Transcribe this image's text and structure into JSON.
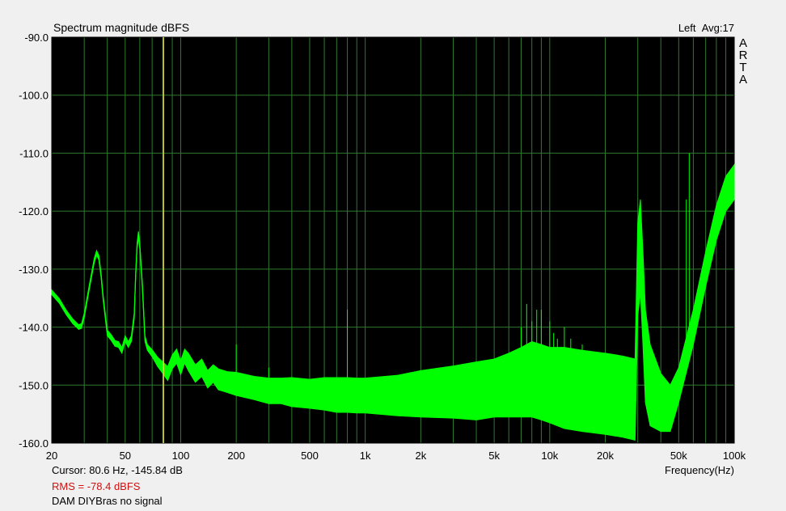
{
  "chart_data": {
    "type": "line",
    "title": "Spectrum magnitude dBFS",
    "channel_label": "Left",
    "avg_label": "Avg:17",
    "xlabel": "Frequency(Hz)",
    "ylabel": "",
    "x_scale": "log",
    "xlim": [
      20,
      100000
    ],
    "ylim": [
      -160,
      -90
    ],
    "grid": true,
    "legend": "none",
    "x_tick_labels": [
      {
        "value": 20,
        "label": "20"
      },
      {
        "value": 50,
        "label": "50"
      },
      {
        "value": 100,
        "label": "100"
      },
      {
        "value": 200,
        "label": "200"
      },
      {
        "value": 500,
        "label": "500"
      },
      {
        "value": 1000,
        "label": "1k"
      },
      {
        "value": 2000,
        "label": "2k"
      },
      {
        "value": 5000,
        "label": "5k"
      },
      {
        "value": 10000,
        "label": "10k"
      },
      {
        "value": 20000,
        "label": "20k"
      },
      {
        "value": 50000,
        "label": "50k"
      },
      {
        "value": 100000,
        "label": "100k"
      }
    ],
    "y_tick_labels": [
      {
        "value": -90,
        "label": "-90.0"
      },
      {
        "value": -100,
        "label": "-100.0"
      },
      {
        "value": -110,
        "label": "-110.0"
      },
      {
        "value": -120,
        "label": "-120.0"
      },
      {
        "value": -130,
        "label": "-130.0"
      },
      {
        "value": -140,
        "label": "-140.0"
      },
      {
        "value": -150,
        "label": "-150.0"
      },
      {
        "value": -160,
        "label": "-160.0"
      }
    ],
    "series": [
      {
        "color": "#00ff00",
        "x": [
          20,
          22,
          24,
          26,
          28,
          29,
          30,
          32,
          34,
          35,
          36,
          37,
          38,
          40,
          42,
          44,
          46,
          48,
          50,
          52,
          54,
          56,
          57,
          58,
          59,
          60,
          62,
          64,
          66,
          70,
          75,
          80,
          85,
          90,
          95,
          100,
          105,
          110,
          120,
          130,
          140,
          150,
          160,
          180,
          200,
          250,
          300,
          350,
          400,
          500,
          600,
          700,
          800,
          900,
          1000,
          1500,
          2000,
          3000,
          4000,
          5000,
          6000,
          7000,
          8000,
          9000,
          10000,
          12000,
          15000,
          20000,
          25000,
          29000,
          30000,
          31000,
          32000,
          33000,
          35000,
          40000,
          45000,
          50000,
          60000,
          70000,
          80000,
          90000,
          100000
        ],
        "y": [
          -134,
          -135.5,
          -137.5,
          -139,
          -140,
          -139.8,
          -138,
          -133,
          -128.5,
          -127.2,
          -128,
          -131,
          -135,
          -141,
          -141.8,
          -142.8,
          -143,
          -144,
          -142,
          -143,
          -142,
          -138,
          -131,
          -126,
          -124,
          -126,
          -133,
          -142,
          -143.5,
          -144.5,
          -146,
          -147,
          -148,
          -146,
          -145,
          -147,
          -145,
          -146,
          -148,
          -147,
          -149,
          -148,
          -149,
          -149.5,
          -149.8,
          -150.5,
          -151,
          -151,
          -151.2,
          -151.5,
          -151.5,
          -151.7,
          -151.7,
          -151.8,
          -151.8,
          -151.8,
          -151.5,
          -151.2,
          -151,
          -150.5,
          -150,
          -149.5,
          -149,
          -149.5,
          -150,
          -150.5,
          -151,
          -151.5,
          -152,
          -152.5,
          -130,
          -126,
          -135,
          -145,
          -150,
          -153,
          -154,
          -150,
          -140,
          -130,
          -122,
          -117,
          -115
        ],
        "width": [
          0.4,
          0.4,
          0.4,
          0.4,
          0.4,
          0.4,
          0.4,
          0.4,
          0.4,
          0.4,
          0.4,
          0.4,
          0.4,
          0.5,
          0.5,
          0.5,
          0.5,
          0.5,
          0.5,
          0.5,
          0.5,
          0.5,
          0.5,
          0.5,
          0.5,
          0.5,
          0.5,
          0.5,
          0.5,
          0.6,
          0.8,
          1.0,
          1.2,
          1.2,
          1.2,
          1.2,
          1.2,
          1.5,
          1.5,
          1.5,
          1.5,
          1.5,
          1.8,
          1.8,
          2.0,
          2.0,
          2.2,
          2.2,
          2.5,
          2.5,
          2.8,
          3.0,
          3.0,
          3.0,
          3.0,
          3.5,
          4.0,
          4.5,
          5.0,
          5.0,
          5.5,
          6.0,
          6.5,
          6.5,
          6.5,
          7.0,
          7.0,
          7.0,
          7.0,
          7.0,
          8.0,
          8.0,
          8.0,
          8.0,
          7.0,
          5.0,
          4.0,
          3.0,
          3.0,
          3.0,
          3.0,
          3.0,
          3.0
        ]
      }
    ],
    "spikes": [
      {
        "x": 200,
        "y": -143
      },
      {
        "x": 300,
        "y": -147
      },
      {
        "x": 800,
        "y": -137
      },
      {
        "x": 7000,
        "y": -140
      },
      {
        "x": 7500,
        "y": -136
      },
      {
        "x": 8000,
        "y": -139
      },
      {
        "x": 8500,
        "y": -137
      },
      {
        "x": 9000,
        "y": -137
      },
      {
        "x": 10000,
        "y": -139
      },
      {
        "x": 10500,
        "y": -141
      },
      {
        "x": 11000,
        "y": -142
      },
      {
        "x": 12000,
        "y": -140
      },
      {
        "x": 13000,
        "y": -142
      },
      {
        "x": 15000,
        "y": -143
      },
      {
        "x": 31000,
        "y": -125
      },
      {
        "x": 31500,
        "y": -124
      },
      {
        "x": 55000,
        "y": -118
      },
      {
        "x": 57000,
        "y": -110
      }
    ],
    "cursor": {
      "x": 80.6,
      "color": "#e0e040"
    },
    "logo_letters": [
      "A",
      "R",
      "T",
      "A"
    ],
    "cursor_readout": "Cursor:    80.6 Hz, -145.84 dB",
    "rms_readout": "RMS =  -78.4 dBFS",
    "note": "DAM DIYBras no signal"
  }
}
